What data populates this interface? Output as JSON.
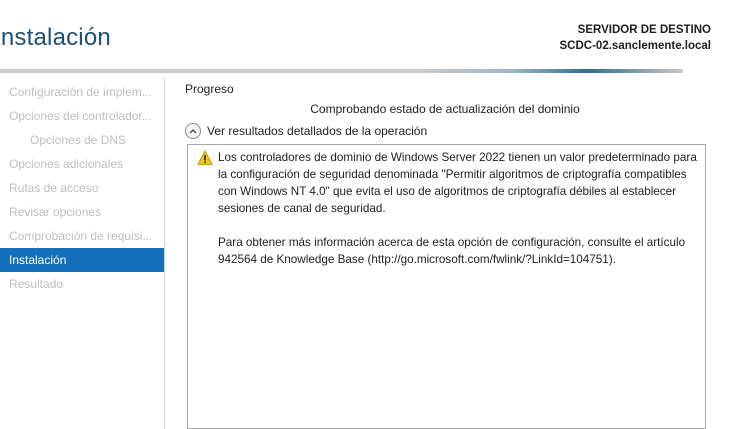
{
  "header": {
    "title": "Instalación",
    "server_label": "SERVIDOR DE DESTINO",
    "server_name": "SCDC-02.sanclemente.local"
  },
  "nav": {
    "items": [
      {
        "label": "Configuración de implem...",
        "state": "disabled"
      },
      {
        "label": "Opciones del controlador...",
        "state": "disabled"
      },
      {
        "label": "Opciones de DNS",
        "state": "disabled"
      },
      {
        "label": "Opciones adicionales",
        "state": "disabled"
      },
      {
        "label": "Rutas de acceso",
        "state": "disabled"
      },
      {
        "label": "Revisar opciones",
        "state": "disabled"
      },
      {
        "label": "Comprobación de requisi...",
        "state": "disabled"
      },
      {
        "label": "Instalación",
        "state": "active"
      },
      {
        "label": "Resultado",
        "state": "disabled"
      }
    ]
  },
  "main": {
    "section_label": "Progreso",
    "status_text": "Comprobando estado de actualización del dominio",
    "details_toggle_label": "Ver resultados detallados de la operación",
    "message_paragraph_1": "Los controladores de dominio de Windows Server 2022 tienen un valor predeterminado para la configuración de seguridad denominada \"Permitir algoritmos de criptografía compatibles con Windows NT 4.0\" que evita el uso de algoritmos de criptografía débiles al establecer sesiones de canal de seguridad.",
    "message_paragraph_2": "Para obtener más información acerca de esta opción de configuración, consulte el artículo 942564 de Knowledge Base (http://go.microsoft.com/fwlink/?LinkId=104751)."
  },
  "colors": {
    "accent": "#1470b8",
    "title": "#1f4e79",
    "disabled_text": "#bdbdbd",
    "warning": "#f2c811"
  },
  "icons": {
    "warning": "warning-icon",
    "toggle": "chevron-up-icon"
  }
}
